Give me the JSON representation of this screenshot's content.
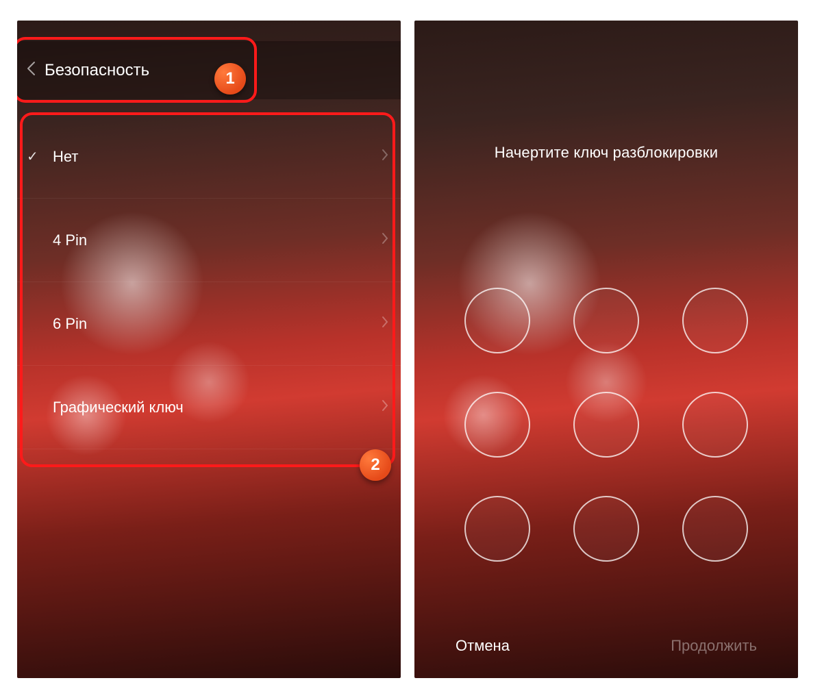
{
  "annotations": {
    "callout1": "1",
    "callout2": "2"
  },
  "screen1": {
    "header": {
      "title": "Безопасность"
    },
    "options": [
      {
        "label": "Нет",
        "selected": true
      },
      {
        "label": "4 Pin",
        "selected": false
      },
      {
        "label": "6 Pin",
        "selected": false
      },
      {
        "label": "Графический ключ",
        "selected": false
      }
    ]
  },
  "screen2": {
    "instruction": "Начертите ключ разблокировки",
    "cancel": "Отмена",
    "continue": "Продолжить"
  },
  "colors": {
    "highlight": "#ff1a1a",
    "callout_bg": "#e64a19"
  }
}
